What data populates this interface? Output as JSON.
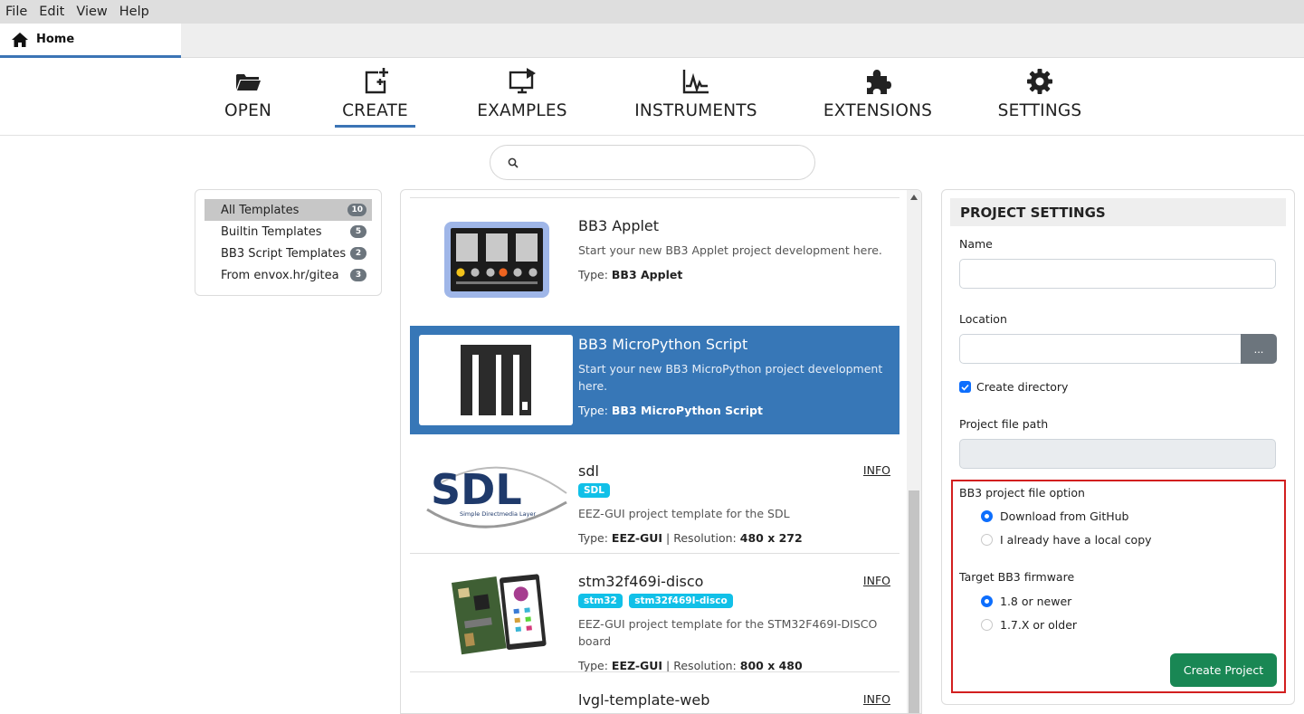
{
  "menubar": {
    "items": [
      "File",
      "Edit",
      "View",
      "Help"
    ]
  },
  "tabs": {
    "home_label": "Home"
  },
  "nav": {
    "open": "OPEN",
    "create": "CREATE",
    "examples": "EXAMPLES",
    "instruments": "INSTRUMENTS",
    "extensions": "EXTENSIONS",
    "settings": "SETTINGS",
    "active": "CREATE"
  },
  "search": {
    "placeholder": "",
    "value": ""
  },
  "filters": [
    {
      "label": "All Templates",
      "count": "10",
      "active": true
    },
    {
      "label": "Builtin Templates",
      "count": "5"
    },
    {
      "label": "BB3 Script Templates",
      "count": "2"
    },
    {
      "label": "From envox.hr/gitea",
      "count": "3"
    }
  ],
  "templates": [
    {
      "title": "BB3 Applet",
      "desc": "Start your new BB3 Applet project development here.",
      "type_prefix": "Type: ",
      "type": "BB3 Applet",
      "icon": "bb3-applet-thumbnail"
    },
    {
      "title": "BB3 MicroPython Script",
      "desc": "Start your new BB3 MicroPython project development here.",
      "type_prefix": "Type: ",
      "type": "BB3 MicroPython Script",
      "selected": true,
      "icon": "micropython-logo"
    },
    {
      "title": "sdl",
      "tags": [
        "SDL"
      ],
      "desc": "EEZ-GUI project template for the SDL",
      "type_prefix": "Type: ",
      "type": "EEZ-GUI",
      "res_prefix": " | Resolution: ",
      "resolution": "480 x 272",
      "info": "INFO",
      "logo_text": "SDL",
      "logo_sub": "Simple Directmedia Layer"
    },
    {
      "title": "stm32f469i-disco",
      "tags": [
        "stm32",
        "stm32f469I-disco"
      ],
      "desc": "EEZ-GUI project template for the STM32F469I-DISCO board",
      "type_prefix": "Type: ",
      "type": "EEZ-GUI",
      "res_prefix": " | Resolution: ",
      "resolution": "800 x 480",
      "info": "INFO",
      "icon": "board-photo"
    },
    {
      "title": "lvgl-template-web",
      "info": "INFO"
    }
  ],
  "settings": {
    "header": "PROJECT SETTINGS",
    "name_label": "Name",
    "name_value": "",
    "location_label": "Location",
    "location_value": "",
    "browse_label": "...",
    "create_directory_label": "Create directory",
    "create_directory_checked": true,
    "project_path_label": "Project file path",
    "project_path_value": "",
    "bb3_option_label": "BB3 project file option",
    "bb3_option_choices": [
      "Download from GitHub",
      "I already have a local copy"
    ],
    "bb3_option_selected": "Download from GitHub",
    "firmware_label": "Target BB3 firmware",
    "firmware_choices": [
      "1.8 or newer",
      "1.7.X or older"
    ],
    "firmware_selected": "1.8 or newer",
    "create_button": "Create Project"
  },
  "colors": {
    "accent": "#3777b7",
    "tag": "#11c0e8",
    "create_button": "#198754",
    "highlight": "#d21f1f"
  }
}
